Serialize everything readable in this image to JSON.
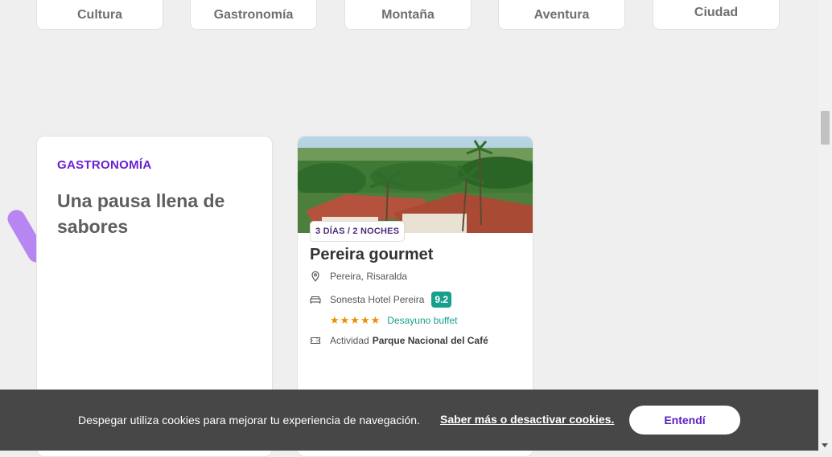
{
  "categories": [
    "Cultura",
    "Gastronomía",
    "Montaña",
    "Aventura",
    "Ciudad"
  ],
  "intro": {
    "kicker": "GASTRONOMÍA",
    "title": "Una pausa llena de sabores"
  },
  "package": {
    "badge": "3 DÍAS / 2 NOCHES",
    "title": "Pereira gourmet",
    "location": "Pereira, Risaralda",
    "hotel": "Sonesta Hotel Pereira",
    "score": "9.2",
    "stars": 5,
    "meal": "Desayuno buffet",
    "activity_prefix": "Actividad",
    "activity_name": "Parque Nacional del Café"
  },
  "cookie": {
    "text": "Despegar utiliza cookies para mejorar tu experiencia de navegación.",
    "link": "Saber más o desactivar cookies.",
    "button": "Entendí"
  },
  "colors": {
    "accent_purple": "#6b1fd1",
    "score_green": "#16a08c",
    "star_orange": "#f08c00",
    "cookie_bg": "#474747"
  }
}
